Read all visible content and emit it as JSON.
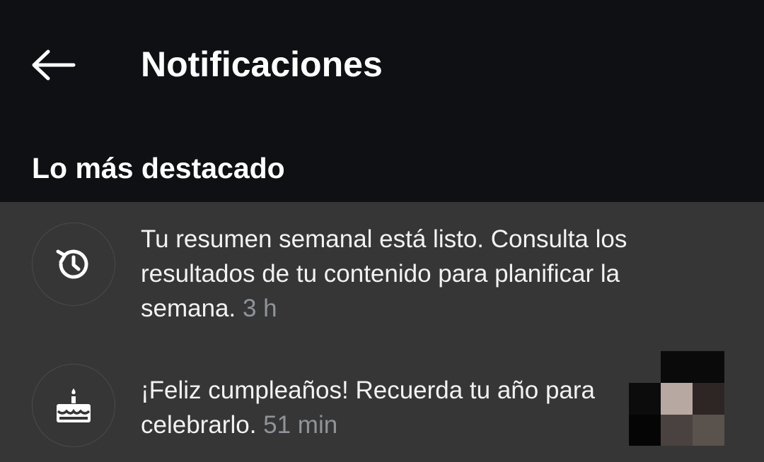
{
  "header": {
    "title": "Notificaciones",
    "back_icon": "arrow-left-icon"
  },
  "section": {
    "heading": "Lo más destacado"
  },
  "notifications": [
    {
      "icon": "history-clock-icon",
      "text": "Tu resumen semanal está listo. Consulta los resultados de tu contenido para planificar la semana.",
      "time": "3 h"
    },
    {
      "icon": "birthday-cake-icon",
      "text": "¡Feliz cumpleaños! Recuerda tu año para celebrarlo.",
      "time": "51 min",
      "thumbnail_colors": [
        "#0a0a0a",
        "#b8a8a2",
        "#2e2624",
        "#4a4240",
        "#5a524c"
      ]
    }
  ],
  "colors": {
    "header_bg": "#0e1013",
    "list_bg": "#363636",
    "time_text": "#8e949a"
  }
}
